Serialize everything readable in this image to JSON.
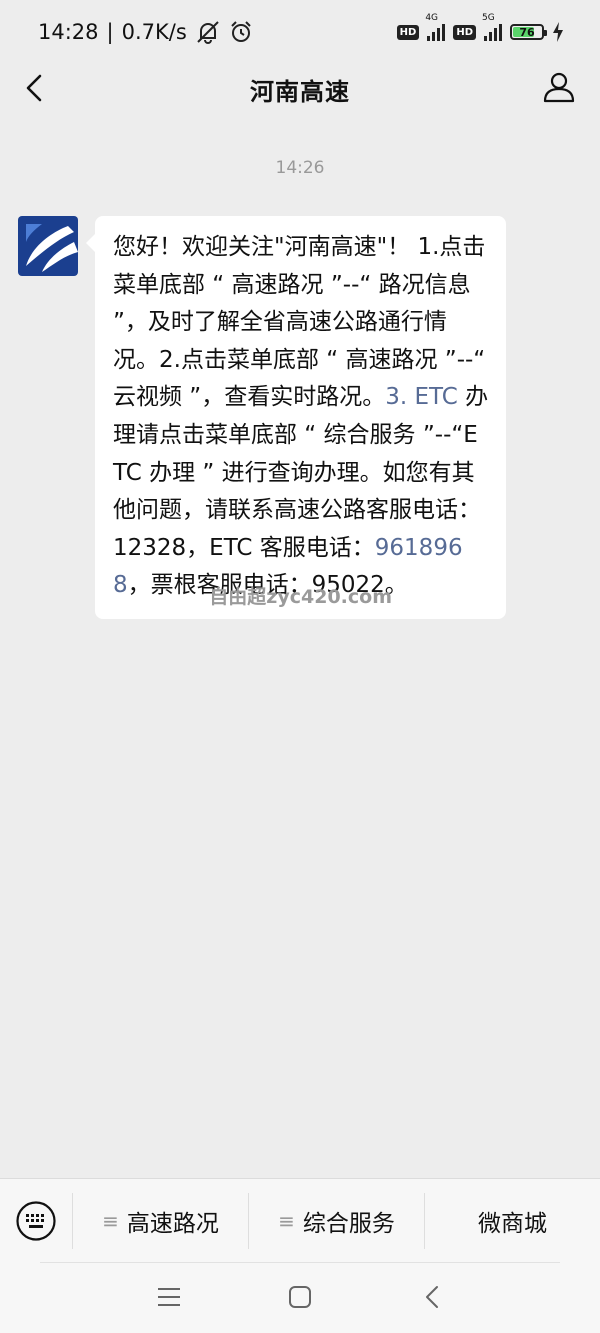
{
  "status_bar": {
    "time": "14:28",
    "separator": "|",
    "net_speed": "0.7K/s",
    "sim1_badge": "HD",
    "sim1_network": "4G",
    "sim2_badge": "HD",
    "sim2_network": "5G",
    "battery_level": "76",
    "battery_fraction": 0.76,
    "battery_color": "#5ad36a",
    "icons": [
      "muted-bell-icon",
      "alarm-icon",
      "signal-icon",
      "battery-icon",
      "charging-icon"
    ]
  },
  "header": {
    "title": "河南高速",
    "icons": [
      "back-icon",
      "profile-icon"
    ]
  },
  "chat": {
    "timestamp": "14:26",
    "message": {
      "part1": "您好！欢迎关注\"河南高速\"！ 1.点击菜单底部 “ 高速路况 ”--“ 路况信息 ”，及时了解全省高速公路通行情况。2.点击菜单底部 “ 高速路况 ”--“ 云视频 ”，查看实时路况。",
      "link1": "3. ETC",
      "part2": " 办理请点击菜单底部 “ 综合服务 ”--“ETC 办理 ” 进行查询办理。如您有其他问题，请联系高速公路客服电话：12328，ETC 客服电话：",
      "link2": "9618968",
      "part3": "，票根客服电话：95022。"
    },
    "watermark": "自由超zyc420.com"
  },
  "menu": {
    "items": [
      {
        "label": "高速路况",
        "icon": "≡"
      },
      {
        "label": "综合服务",
        "icon": "≡"
      },
      {
        "label": "微商城"
      }
    ]
  },
  "colors": {
    "background": "#ededed",
    "bubble": "#ffffff",
    "link": "#576b95",
    "timestamp": "#999999"
  }
}
